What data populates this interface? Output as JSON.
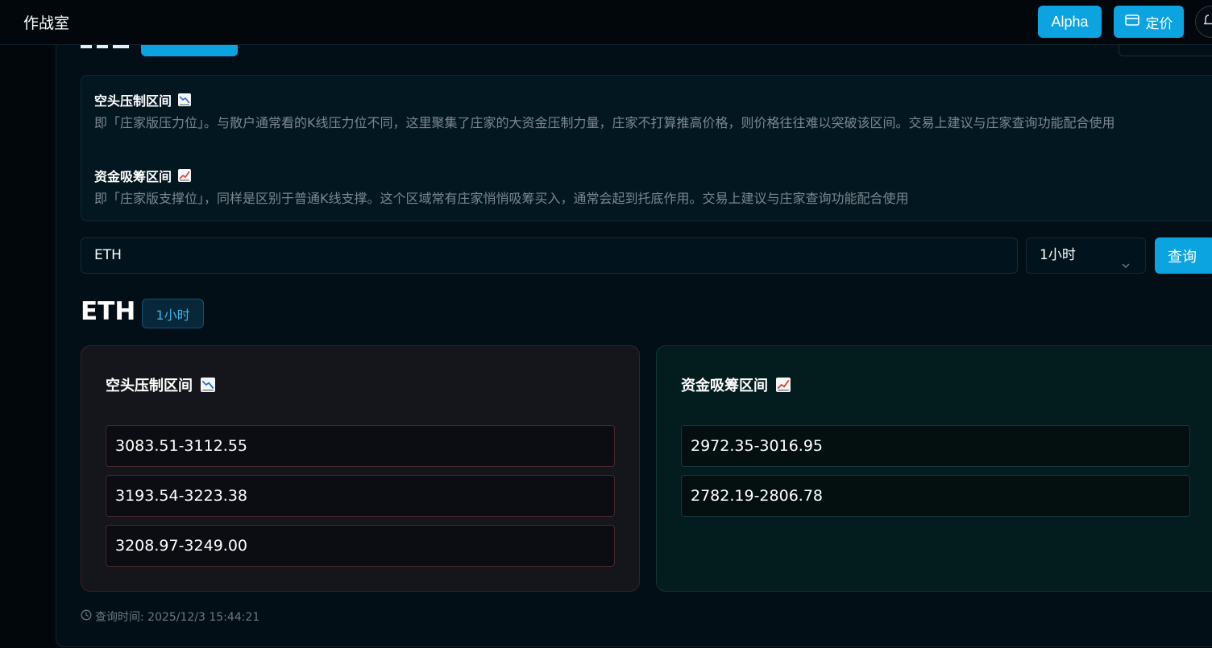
{
  "app": {
    "title": "作战室"
  },
  "topbar": {
    "alpha_label": "Alpha",
    "pricing_label": "定价"
  },
  "info": {
    "short_title": "空头压制区间",
    "short_desc": "即「庄家版压力位」。与散户通常看的K线压力位不同，这里聚集了庄家的大资金压制力量，庄家不打算推高价格，则价格往往难以突破该区间。交易上建议与庄家查询功能配合使用",
    "long_title": "资金吸筹区间",
    "long_desc": "即「庄家版支撑位」，同样是区别于普通K线支撑。这个区域常有庄家悄悄吸筹买入，通常会起到托底作用。交易上建议与庄家查询功能配合使用"
  },
  "search": {
    "value": "ETH",
    "interval": "1小时",
    "query_label": "查询"
  },
  "result": {
    "symbol": "ETH",
    "interval": "1小时",
    "short_card": {
      "title": "空头压制区间",
      "zones": [
        "3083.51-3112.55",
        "3193.54-3223.38",
        "3208.97-3249.00"
      ]
    },
    "long_card": {
      "title": "资金吸筹区间",
      "zones": [
        "2972.35-3016.95",
        "2782.19-2806.78"
      ]
    },
    "query_time": "查询时间: 2025/12/3 15:44:21"
  },
  "colors": {
    "accent": "#0ba3e0",
    "short_border": "#4a262c",
    "long_border": "#13393b"
  },
  "icons": [
    "chart-decreasing-icon",
    "chart-increasing-icon",
    "chevron-down-icon",
    "clock-icon",
    "card-icon"
  ]
}
